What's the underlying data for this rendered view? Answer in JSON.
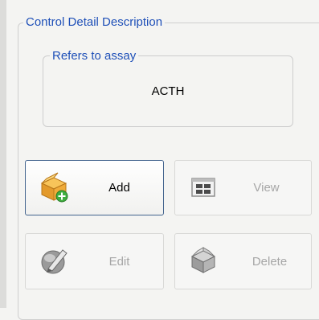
{
  "group": {
    "title": "Control Detail Description"
  },
  "assay": {
    "title": "Refers to assay",
    "value": "ACTH"
  },
  "buttons": {
    "add": {
      "label": "Add",
      "icon": "box-add-icon",
      "enabled": true
    },
    "view": {
      "label": "View",
      "icon": "view-grid-icon",
      "enabled": false
    },
    "edit": {
      "label": "Edit",
      "icon": "edit-pen-icon",
      "enabled": false
    },
    "delete": {
      "label": "Delete",
      "icon": "delete-box-icon",
      "enabled": false
    }
  },
  "colors": {
    "legend_text": "#1f50b8",
    "disabled_text": "#a6a6a6",
    "enabled_border": "#43648e",
    "background": "#f4f4f2"
  }
}
